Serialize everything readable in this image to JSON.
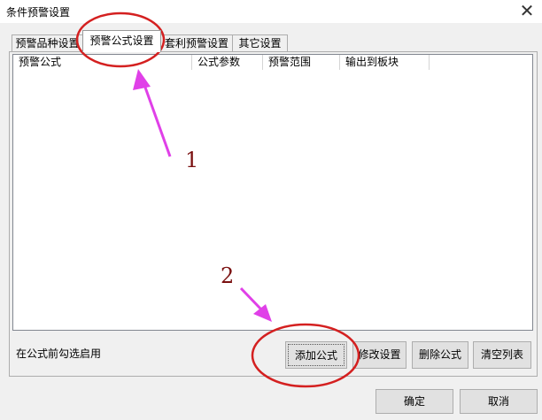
{
  "window": {
    "title": "条件预警设置",
    "close_label": "✕"
  },
  "tabs": [
    {
      "label": "预警品种设置",
      "active": false
    },
    {
      "label": "预警公式设置",
      "active": true
    },
    {
      "label": "套利预警设置",
      "active": false
    },
    {
      "label": "其它设置",
      "active": false
    }
  ],
  "list": {
    "columns": [
      "预警公式",
      "公式参数",
      "预警范围",
      "输出到板块"
    ]
  },
  "footer": {
    "hint": "在公式前勾选启用",
    "buttons": [
      "添加公式",
      "修改设置",
      "删除公式",
      "清空列表"
    ]
  },
  "dialog_buttons": {
    "ok": "确定",
    "cancel": "取消"
  },
  "annotations": {
    "step1": "1",
    "step2": "2",
    "arrow_color": "#e040e8",
    "circle_color": "#d42020"
  }
}
